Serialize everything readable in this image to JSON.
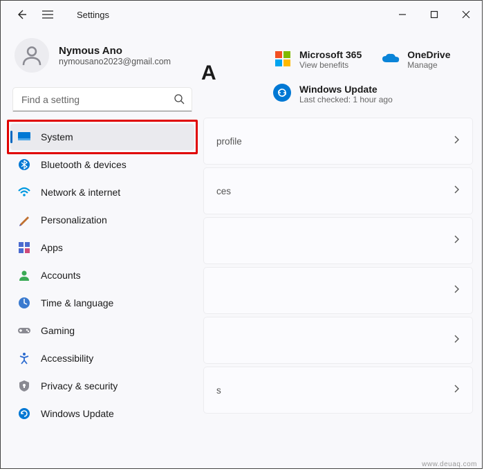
{
  "window": {
    "title": "Settings"
  },
  "account": {
    "name": "Nymous Ano",
    "email": "nymousano2023@gmail.com"
  },
  "search": {
    "placeholder": "Find a setting"
  },
  "nav": {
    "system": "System",
    "bluetooth": "Bluetooth & devices",
    "network": "Network & internet",
    "personalization": "Personalization",
    "apps": "Apps",
    "accounts": "Accounts",
    "time": "Time & language",
    "gaming": "Gaming",
    "accessibility": "Accessibility",
    "privacy": "Privacy & security",
    "update": "Windows Update"
  },
  "main": {
    "heading_fragment": "A",
    "ms365": {
      "title": "Microsoft 365",
      "sub": "View benefits"
    },
    "onedrive": {
      "title": "OneDrive",
      "sub": "Manage"
    },
    "winupdate": {
      "title": "Windows Update",
      "sub": "Last checked: 1 hour ago"
    },
    "cards": {
      "c1": "profile",
      "c2": "ces",
      "c3": "",
      "c4": "",
      "c5": "",
      "c6": "s"
    }
  },
  "watermark": "www.deuaq.com"
}
